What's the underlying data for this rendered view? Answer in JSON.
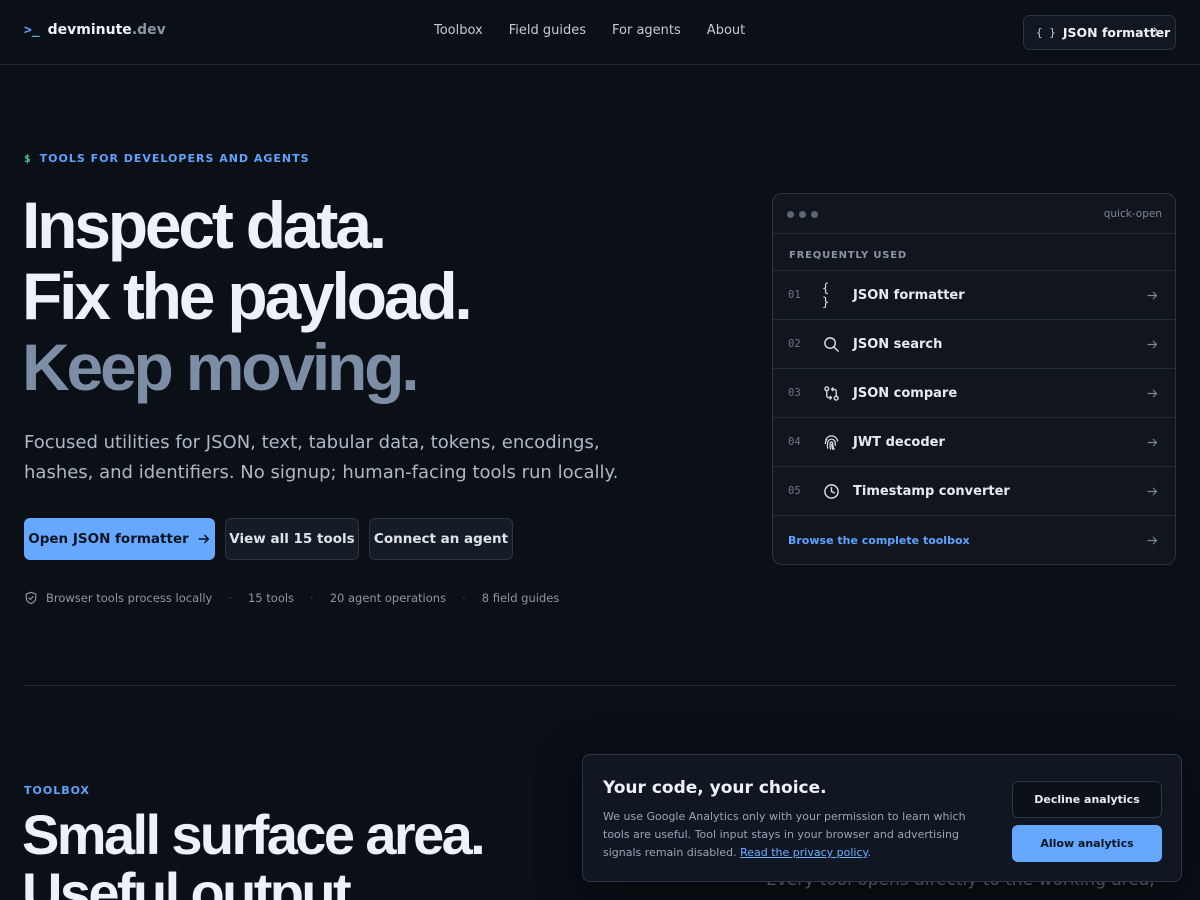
{
  "header": {
    "brand_prompt": ">_",
    "brand_name": "devminute",
    "brand_tld": ".dev",
    "nav": [
      "Toolbox",
      "Field guides",
      "For agents",
      "About"
    ],
    "cta_icon": "{ }",
    "cta_label": "JSON formatter"
  },
  "hero": {
    "eyebrow_prefix": "$",
    "eyebrow": "TOOLS FOR DEVELOPERS AND AGENTS",
    "line1": "Inspect data.",
    "line2": "Fix the payload.",
    "line3": "Keep moving.",
    "lede": "Focused utilities for JSON, text, tabular data, tokens, encodings, hashes, and identifiers. No signup; human-facing tools run locally.",
    "primary_button": "Open JSON formatter",
    "tools_button": "View all 15 tools",
    "agent_button": "Connect an agent",
    "stats": [
      "Browser tools process locally",
      "15 tools",
      "20 agent operations",
      "8 field guides"
    ],
    "stat_separator": "·"
  },
  "quick_open": {
    "label": "quick-open",
    "section": "FREQUENTLY USED",
    "items": [
      {
        "num": "01",
        "icon": "braces-icon",
        "label": "JSON formatter"
      },
      {
        "num": "02",
        "icon": "search-icon",
        "label": "JSON search"
      },
      {
        "num": "03",
        "icon": "compare-icon",
        "label": "JSON compare"
      },
      {
        "num": "04",
        "icon": "fingerprint-icon",
        "label": "JWT decoder"
      },
      {
        "num": "05",
        "icon": "clock-icon",
        "label": "Timestamp converter"
      }
    ],
    "footer": "Browse the complete toolbox"
  },
  "toolbox": {
    "eyebrow": "TOOLBOX",
    "line1": "Small surface area.",
    "line2": "Useful output.",
    "copy": "Every tool opens directly to the working area, handles"
  },
  "consent": {
    "title": "Your code, your choice.",
    "body": "We use Google Analytics only with your permission to learn which tools are useful. Tool input stays in your browser and advertising signals remain disabled.",
    "link": "Read the privacy policy",
    "link_suffix": ".",
    "decline": "Decline analytics",
    "allow": "Allow analytics"
  },
  "colors": {
    "background": "#0b0f16",
    "accent": "#66a8ff",
    "eyebrow": "#5fa3ff",
    "prompt_green": "#3ecf8e",
    "muted_headline": "#7c8ea5"
  }
}
